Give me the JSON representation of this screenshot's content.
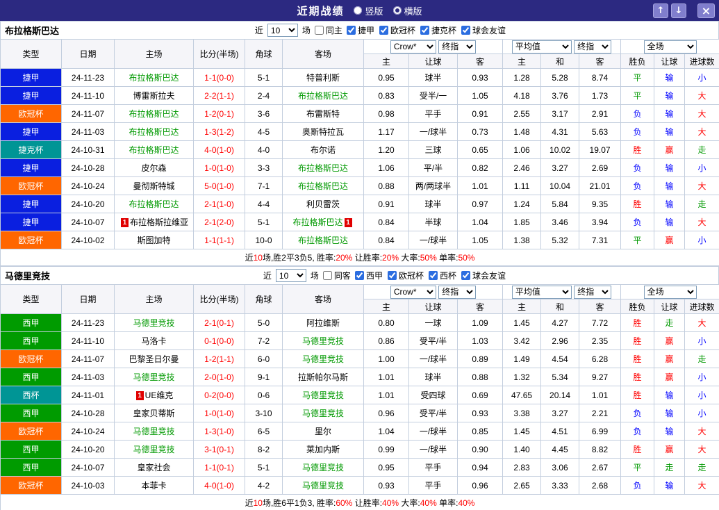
{
  "titlebar": {
    "title": "近期战绩",
    "radios": [
      {
        "label": "竖版",
        "checked": false
      },
      {
        "label": "横版",
        "checked": true
      }
    ],
    "up_icon": "↑",
    "down_icon": "↓",
    "close_icon": "×"
  },
  "colors": {
    "titlebar_bg": "#2c2981",
    "league_blue": "#0a1fe0",
    "league_orange": "#ff6600",
    "league_teal": "#009595",
    "league_green": "#009b00",
    "focus_team_green": "#009900",
    "score_red": "#ff0000",
    "win_red": "#ff0000",
    "draw_green": "#009900",
    "loss_blue": "#0000ff"
  },
  "columns": {
    "type": "类型",
    "date": "日期",
    "home": "主场",
    "score": "比分(半场)",
    "corner": "角球",
    "away": "客场",
    "sub": {
      "h": "主",
      "handicap": "让球",
      "a": "客",
      "avg_h": "主",
      "avg_d": "和",
      "avg_a": "客",
      "wdl": "胜负",
      "hc": "让球",
      "goals": "进球数"
    }
  },
  "sections": [
    {
      "team": "布拉格斯巴达",
      "filter": {
        "near": "近",
        "count": "10",
        "games": "场",
        "same": "同主",
        "same_checked": false,
        "leagues": [
          {
            "label": "捷甲",
            "checked": true
          },
          {
            "label": "欧冠杯",
            "checked": true
          },
          {
            "label": "捷克杯",
            "checked": true
          },
          {
            "label": "球会友谊",
            "checked": true
          }
        ]
      },
      "selects": {
        "company": "Crow*",
        "final1": "终指",
        "average": "平均值",
        "final2": "终指",
        "scope": "全场"
      },
      "rows": [
        {
          "league": "捷甲",
          "cls": "lg-blue",
          "date": "24-11-23",
          "home": {
            "name": "布拉格斯巴达",
            "focus": true,
            "card": ""
          },
          "score": "1-1(0-0)",
          "corner": "5-1",
          "away": {
            "name": "特普利斯",
            "focus": false,
            "card": ""
          },
          "odds": [
            "0.95",
            "球半",
            "0.93"
          ],
          "avg": [
            "1.28",
            "5.28",
            "8.74"
          ],
          "res": [
            [
              "平",
              "g"
            ],
            [
              "输",
              "b"
            ],
            [
              "小",
              "b"
            ]
          ]
        },
        {
          "league": "捷甲",
          "cls": "lg-blue",
          "date": "24-11-10",
          "home": {
            "name": "博雷斯拉夫",
            "focus": false,
            "card": ""
          },
          "score": "2-2(1-1)",
          "corner": "2-4",
          "away": {
            "name": "布拉格斯巴达",
            "focus": true,
            "card": ""
          },
          "odds": [
            "0.83",
            "受半/一",
            "1.05"
          ],
          "avg": [
            "4.18",
            "3.76",
            "1.73"
          ],
          "res": [
            [
              "平",
              "g"
            ],
            [
              "输",
              "b"
            ],
            [
              "大",
              "r"
            ]
          ]
        },
        {
          "league": "欧冠杯",
          "cls": "lg-orange",
          "date": "24-11-07",
          "home": {
            "name": "布拉格斯巴达",
            "focus": true,
            "card": ""
          },
          "score": "1-2(0-1)",
          "corner": "3-6",
          "away": {
            "name": "布雷斯特",
            "focus": false,
            "card": ""
          },
          "odds": [
            "0.98",
            "平手",
            "0.91"
          ],
          "avg": [
            "2.55",
            "3.17",
            "2.91"
          ],
          "res": [
            [
              "负",
              "b"
            ],
            [
              "输",
              "b"
            ],
            [
              "大",
              "r"
            ]
          ]
        },
        {
          "league": "捷甲",
          "cls": "lg-blue",
          "date": "24-11-03",
          "home": {
            "name": "布拉格斯巴达",
            "focus": true,
            "card": ""
          },
          "score": "1-3(1-2)",
          "corner": "4-5",
          "away": {
            "name": "奥斯特拉瓦",
            "focus": false,
            "card": ""
          },
          "odds": [
            "1.17",
            "一/球半",
            "0.73"
          ],
          "avg": [
            "1.48",
            "4.31",
            "5.63"
          ],
          "res": [
            [
              "负",
              "b"
            ],
            [
              "输",
              "b"
            ],
            [
              "大",
              "r"
            ]
          ]
        },
        {
          "league": "捷克杯",
          "cls": "lg-teal",
          "date": "24-10-31",
          "home": {
            "name": "布拉格斯巴达",
            "focus": true,
            "card": ""
          },
          "score": "4-0(1-0)",
          "corner": "4-0",
          "away": {
            "name": "布尔诺",
            "focus": false,
            "card": ""
          },
          "odds": [
            "1.20",
            "三球",
            "0.65"
          ],
          "avg": [
            "1.06",
            "10.02",
            "19.07"
          ],
          "res": [
            [
              "胜",
              "r"
            ],
            [
              "赢",
              "r"
            ],
            [
              "走",
              "g"
            ]
          ]
        },
        {
          "league": "捷甲",
          "cls": "lg-blue",
          "date": "24-10-28",
          "home": {
            "name": "皮尔森",
            "focus": false,
            "card": ""
          },
          "score": "1-0(1-0)",
          "corner": "3-3",
          "away": {
            "name": "布拉格斯巴达",
            "focus": true,
            "card": ""
          },
          "odds": [
            "1.06",
            "平/半",
            "0.82"
          ],
          "avg": [
            "2.46",
            "3.27",
            "2.69"
          ],
          "res": [
            [
              "负",
              "b"
            ],
            [
              "输",
              "b"
            ],
            [
              "小",
              "b"
            ]
          ]
        },
        {
          "league": "欧冠杯",
          "cls": "lg-orange",
          "date": "24-10-24",
          "home": {
            "name": "曼彻斯特城",
            "focus": false,
            "card": ""
          },
          "score": "5-0(1-0)",
          "corner": "7-1",
          "away": {
            "name": "布拉格斯巴达",
            "focus": true,
            "card": ""
          },
          "odds": [
            "0.88",
            "两/两球半",
            "1.01"
          ],
          "avg": [
            "1.11",
            "10.04",
            "21.01"
          ],
          "res": [
            [
              "负",
              "b"
            ],
            [
              "输",
              "b"
            ],
            [
              "大",
              "r"
            ]
          ]
        },
        {
          "league": "捷甲",
          "cls": "lg-blue",
          "date": "24-10-20",
          "home": {
            "name": "布拉格斯巴达",
            "focus": true,
            "card": ""
          },
          "score": "2-1(1-0)",
          "corner": "4-4",
          "away": {
            "name": "利贝雷茨",
            "focus": false,
            "card": ""
          },
          "odds": [
            "0.91",
            "球半",
            "0.97"
          ],
          "avg": [
            "1.24",
            "5.84",
            "9.35"
          ],
          "res": [
            [
              "胜",
              "r"
            ],
            [
              "输",
              "b"
            ],
            [
              "走",
              "g"
            ]
          ]
        },
        {
          "league": "捷甲",
          "cls": "lg-blue",
          "date": "24-10-07",
          "home": {
            "name": "布拉格斯拉维亚",
            "focus": false,
            "card": "1"
          },
          "score": "2-1(2-0)",
          "corner": "5-1",
          "away": {
            "name": "布拉格斯巴达",
            "focus": true,
            "card": "1"
          },
          "odds": [
            "0.84",
            "半球",
            "1.04"
          ],
          "avg": [
            "1.85",
            "3.46",
            "3.94"
          ],
          "res": [
            [
              "负",
              "b"
            ],
            [
              "输",
              "b"
            ],
            [
              "大",
              "r"
            ]
          ]
        },
        {
          "league": "欧冠杯",
          "cls": "lg-orange",
          "date": "24-10-02",
          "home": {
            "name": "斯图加特",
            "focus": false,
            "card": ""
          },
          "score": "1-1(1-1)",
          "corner": "10-0",
          "away": {
            "name": "布拉格斯巴达",
            "focus": true,
            "card": ""
          },
          "odds": [
            "0.84",
            "一/球半",
            "1.05"
          ],
          "avg": [
            "1.38",
            "5.32",
            "7.31"
          ],
          "res": [
            [
              "平",
              "g"
            ],
            [
              "赢",
              "r"
            ],
            [
              "小",
              "b"
            ]
          ]
        }
      ],
      "summary": [
        {
          "t": "近"
        },
        {
          "t": "10",
          "r": true
        },
        {
          "t": "场,胜2平3负5, 胜率:"
        },
        {
          "t": "20%",
          "r": true
        },
        {
          "t": " 让胜率:"
        },
        {
          "t": "20%",
          "r": true
        },
        {
          "t": " 大率:"
        },
        {
          "t": "50%",
          "r": true
        },
        {
          "t": " 单率:"
        },
        {
          "t": "50%",
          "r": true
        }
      ]
    },
    {
      "team": "马德里竞技",
      "filter": {
        "near": "近",
        "count": "10",
        "games": "场",
        "same": "同客",
        "same_checked": false,
        "leagues": [
          {
            "label": "西甲",
            "checked": true
          },
          {
            "label": "欧冠杯",
            "checked": true
          },
          {
            "label": "西杯",
            "checked": true
          },
          {
            "label": "球会友谊",
            "checked": true
          }
        ]
      },
      "selects": {
        "company": "Crow*",
        "final1": "终指",
        "average": "平均值",
        "final2": "终指",
        "scope": "全场"
      },
      "rows": [
        {
          "league": "西甲",
          "cls": "lg-green",
          "date": "24-11-23",
          "home": {
            "name": "马德里竞技",
            "focus": true,
            "card": ""
          },
          "score": "2-1(0-1)",
          "corner": "5-0",
          "away": {
            "name": "阿拉维斯",
            "focus": false,
            "card": ""
          },
          "odds": [
            "0.80",
            "一球",
            "1.09"
          ],
          "avg": [
            "1.45",
            "4.27",
            "7.72"
          ],
          "res": [
            [
              "胜",
              "r"
            ],
            [
              "走",
              "g"
            ],
            [
              "大",
              "r"
            ]
          ]
        },
        {
          "league": "西甲",
          "cls": "lg-green",
          "date": "24-11-10",
          "home": {
            "name": "马洛卡",
            "focus": false,
            "card": ""
          },
          "score": "0-1(0-0)",
          "corner": "7-2",
          "away": {
            "name": "马德里竞技",
            "focus": true,
            "card": ""
          },
          "odds": [
            "0.86",
            "受平/半",
            "1.03"
          ],
          "avg": [
            "3.42",
            "2.96",
            "2.35"
          ],
          "res": [
            [
              "胜",
              "r"
            ],
            [
              "赢",
              "r"
            ],
            [
              "小",
              "b"
            ]
          ]
        },
        {
          "league": "欧冠杯",
          "cls": "lg-orange",
          "date": "24-11-07",
          "home": {
            "name": "巴黎圣日尔曼",
            "focus": false,
            "card": ""
          },
          "score": "1-2(1-1)",
          "corner": "6-0",
          "away": {
            "name": "马德里竞技",
            "focus": true,
            "card": ""
          },
          "odds": [
            "1.00",
            "一/球半",
            "0.89"
          ],
          "avg": [
            "1.49",
            "4.54",
            "6.28"
          ],
          "res": [
            [
              "胜",
              "r"
            ],
            [
              "赢",
              "r"
            ],
            [
              "走",
              "g"
            ]
          ]
        },
        {
          "league": "西甲",
          "cls": "lg-green",
          "date": "24-11-03",
          "home": {
            "name": "马德里竞技",
            "focus": true,
            "card": ""
          },
          "score": "2-0(1-0)",
          "corner": "9-1",
          "away": {
            "name": "拉斯帕尔马斯",
            "focus": false,
            "card": ""
          },
          "odds": [
            "1.01",
            "球半",
            "0.88"
          ],
          "avg": [
            "1.32",
            "5.34",
            "9.27"
          ],
          "res": [
            [
              "胜",
              "r"
            ],
            [
              "赢",
              "r"
            ],
            [
              "小",
              "b"
            ]
          ]
        },
        {
          "league": "西杯",
          "cls": "lg-teal",
          "date": "24-11-01",
          "home": {
            "name": "UE维克",
            "focus": false,
            "card": "1"
          },
          "score": "0-2(0-0)",
          "corner": "0-6",
          "away": {
            "name": "马德里竞技",
            "focus": true,
            "card": ""
          },
          "odds": [
            "1.01",
            "受四球",
            "0.69"
          ],
          "avg": [
            "47.65",
            "20.14",
            "1.01"
          ],
          "res": [
            [
              "胜",
              "r"
            ],
            [
              "输",
              "b"
            ],
            [
              "小",
              "b"
            ]
          ]
        },
        {
          "league": "西甲",
          "cls": "lg-green",
          "date": "24-10-28",
          "home": {
            "name": "皇家贝蒂斯",
            "focus": false,
            "card": ""
          },
          "score": "1-0(1-0)",
          "corner": "3-10",
          "away": {
            "name": "马德里竞技",
            "focus": true,
            "card": ""
          },
          "odds": [
            "0.96",
            "受平/半",
            "0.93"
          ],
          "avg": [
            "3.38",
            "3.27",
            "2.21"
          ],
          "res": [
            [
              "负",
              "b"
            ],
            [
              "输",
              "b"
            ],
            [
              "小",
              "b"
            ]
          ]
        },
        {
          "league": "欧冠杯",
          "cls": "lg-orange",
          "date": "24-10-24",
          "home": {
            "name": "马德里竞技",
            "focus": true,
            "card": ""
          },
          "score": "1-3(1-0)",
          "corner": "6-5",
          "away": {
            "name": "里尔",
            "focus": false,
            "card": ""
          },
          "odds": [
            "1.04",
            "一/球半",
            "0.85"
          ],
          "avg": [
            "1.45",
            "4.51",
            "6.99"
          ],
          "res": [
            [
              "负",
              "b"
            ],
            [
              "输",
              "b"
            ],
            [
              "大",
              "r"
            ]
          ]
        },
        {
          "league": "西甲",
          "cls": "lg-green",
          "date": "24-10-20",
          "home": {
            "name": "马德里竞技",
            "focus": true,
            "card": ""
          },
          "score": "3-1(0-1)",
          "corner": "8-2",
          "away": {
            "name": "莱加内斯",
            "focus": false,
            "card": ""
          },
          "odds": [
            "0.99",
            "一/球半",
            "0.90"
          ],
          "avg": [
            "1.40",
            "4.45",
            "8.82"
          ],
          "res": [
            [
              "胜",
              "r"
            ],
            [
              "赢",
              "r"
            ],
            [
              "大",
              "r"
            ]
          ]
        },
        {
          "league": "西甲",
          "cls": "lg-green",
          "date": "24-10-07",
          "home": {
            "name": "皇家社会",
            "focus": false,
            "card": ""
          },
          "score": "1-1(0-1)",
          "corner": "5-1",
          "away": {
            "name": "马德里竞技",
            "focus": true,
            "card": ""
          },
          "odds": [
            "0.95",
            "平手",
            "0.94"
          ],
          "avg": [
            "2.83",
            "3.06",
            "2.67"
          ],
          "res": [
            [
              "平",
              "g"
            ],
            [
              "走",
              "g"
            ],
            [
              "走",
              "g"
            ]
          ]
        },
        {
          "league": "欧冠杯",
          "cls": "lg-orange",
          "date": "24-10-03",
          "home": {
            "name": "本菲卡",
            "focus": false,
            "card": ""
          },
          "score": "4-0(1-0)",
          "corner": "4-2",
          "away": {
            "name": "马德里竞技",
            "focus": true,
            "card": ""
          },
          "odds": [
            "0.93",
            "平手",
            "0.96"
          ],
          "avg": [
            "2.65",
            "3.33",
            "2.68"
          ],
          "res": [
            [
              "负",
              "b"
            ],
            [
              "输",
              "b"
            ],
            [
              "大",
              "r"
            ]
          ]
        }
      ],
      "summary": [
        {
          "t": "近"
        },
        {
          "t": "10",
          "r": true
        },
        {
          "t": "场,胜6平1负3, 胜率:"
        },
        {
          "t": "60%",
          "r": true
        },
        {
          "t": " 让胜率:"
        },
        {
          "t": "40%",
          "r": true
        },
        {
          "t": " 大率:"
        },
        {
          "t": "40%",
          "r": true
        },
        {
          "t": " 单率:"
        },
        {
          "t": "40%",
          "r": true
        }
      ]
    }
  ]
}
